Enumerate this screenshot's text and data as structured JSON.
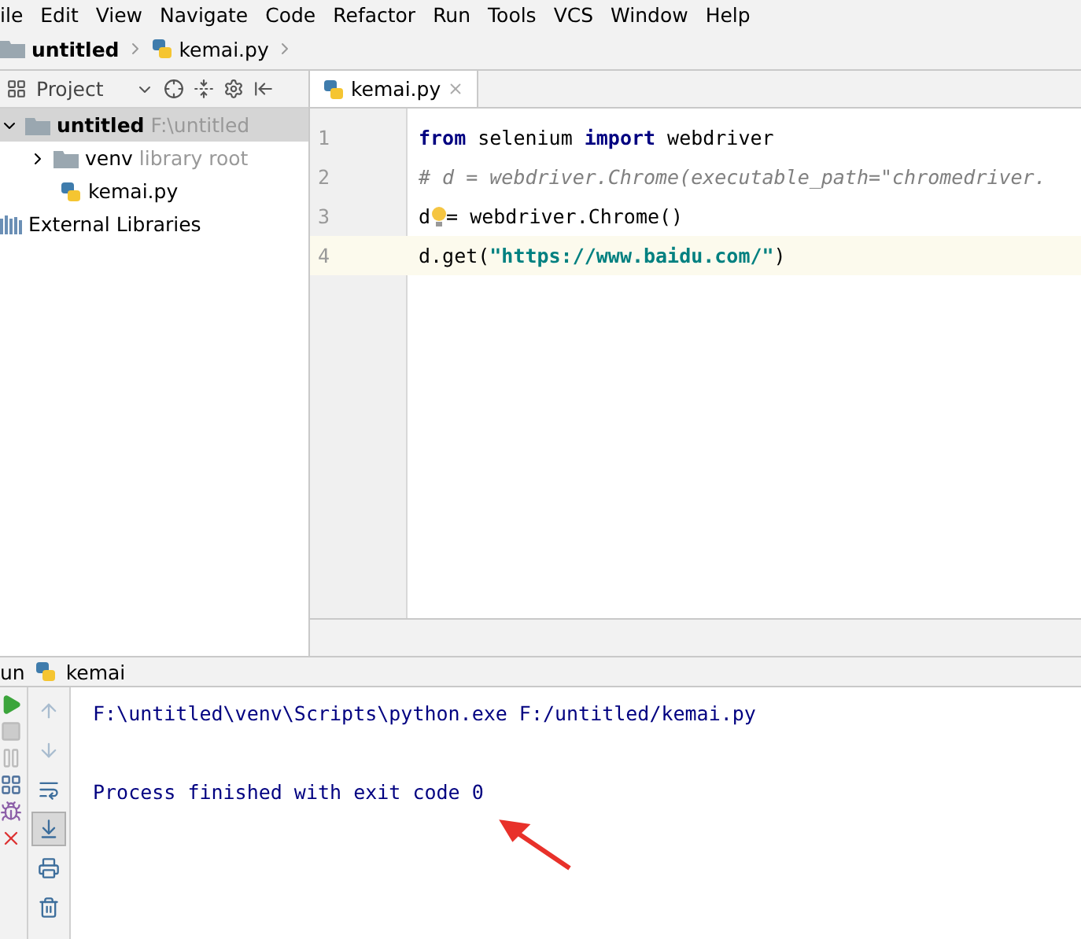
{
  "menu": [
    "ile",
    "Edit",
    "View",
    "Navigate",
    "Code",
    "Refactor",
    "Run",
    "Tools",
    "VCS",
    "Window",
    "Help"
  ],
  "breadcrumb": [
    {
      "label": "untitled",
      "kind": "folder"
    },
    {
      "label": "kemai.py",
      "kind": "python"
    }
  ],
  "project_panel": {
    "title": "Project",
    "tree": [
      {
        "label": "untitled",
        "hint": "F:\\untitled",
        "kind": "folder",
        "expanded": true,
        "selected": true,
        "children": [
          {
            "label": "venv",
            "hint": "library root",
            "kind": "folder",
            "expanded": false,
            "selected": false
          },
          {
            "label": "kemai.py",
            "kind": "python",
            "selected": false
          }
        ]
      },
      {
        "label": "External Libraries",
        "kind": "library",
        "selected": false
      }
    ]
  },
  "editor": {
    "tabs": [
      {
        "label": "kemai.py",
        "selected": true
      }
    ],
    "lines": [
      {
        "number": "1",
        "current": false,
        "tokens": [
          {
            "kind": "keyword",
            "text": "from"
          },
          {
            "kind": "plain",
            "text": " selenium "
          },
          {
            "kind": "keyword",
            "text": "import"
          },
          {
            "kind": "plain",
            "text": " webdriver"
          }
        ]
      },
      {
        "number": "2",
        "current": false,
        "tokens": [
          {
            "kind": "comment",
            "text": "# d = webdriver.Chrome(executable_path=\"chromedriver."
          }
        ]
      },
      {
        "number": "3",
        "current": false,
        "tokens": [
          {
            "kind": "plain",
            "text": "d"
          },
          {
            "kind": "bulb"
          },
          {
            "kind": "plain",
            "text": "= webdriver.Chrome()"
          }
        ]
      },
      {
        "number": "4",
        "current": true,
        "tokens": [
          {
            "kind": "plain",
            "text": "d.get("
          },
          {
            "kind": "string",
            "text": "\"https://www.baidu.com/\""
          },
          {
            "kind": "plain",
            "text": ")"
          }
        ]
      }
    ]
  },
  "run_panel": {
    "title": "un",
    "config": "kemai",
    "tools": [
      {
        "disabled": true,
        "selected": false
      },
      {
        "disabled": true,
        "selected": false
      },
      {
        "disabled": false,
        "selected": false
      },
      {
        "disabled": false,
        "selected": true
      },
      {
        "disabled": false,
        "selected": false
      },
      {
        "disabled": false,
        "selected": false
      }
    ],
    "output": [
      "F:\\untitled\\venv\\Scripts\\python.exe F:/untitled/kemai.py",
      "Process finished with exit code 0"
    ]
  }
}
